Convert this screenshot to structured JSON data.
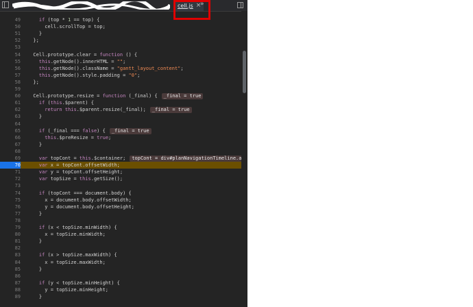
{
  "tabs": {
    "active_label": "cell.js",
    "close_glyph": "×",
    "overflow_glyph": "»"
  },
  "lines": [
    {
      "n": "49",
      "t": "    if (top * 1 == top) {"
    },
    {
      "n": "50",
      "t": "      cell.scrollTop = top;"
    },
    {
      "n": "51",
      "t": "    }"
    },
    {
      "n": "52",
      "t": "  };"
    },
    {
      "n": "53",
      "t": ""
    },
    {
      "n": "54",
      "t": "  Cell.prototype.clear = function () {"
    },
    {
      "n": "55",
      "t": "    this.getNode().innerHTML = \"\";"
    },
    {
      "n": "56",
      "t": "    this.getNode().className = \"gantt_layout_content\";"
    },
    {
      "n": "57",
      "t": "    this.getNode().style.padding = \"0\";"
    },
    {
      "n": "58",
      "t": "  };"
    },
    {
      "n": "59",
      "t": ""
    },
    {
      "n": "60",
      "t": "  Cell.prototype.resize = function (_final) {",
      "hint": "_final = true"
    },
    {
      "n": "61",
      "t": "    if (this.$parent) {"
    },
    {
      "n": "62",
      "t": "      return this.$parent.resize(_final);",
      "hint": "_final = true"
    },
    {
      "n": "63",
      "t": "    }"
    },
    {
      "n": "64",
      "t": ""
    },
    {
      "n": "65",
      "t": "    if (_final === false) {",
      "hint": "_final = true"
    },
    {
      "n": "66",
      "t": "      this.$preResize = true;"
    },
    {
      "n": "67",
      "t": "    }"
    },
    {
      "n": "68",
      "t": ""
    },
    {
      "n": "69",
      "t": "    var topCont = this.$container;",
      "hint": "topCont = div#planNavigationTimeline.aw-gan"
    },
    {
      "n": "70",
      "t": "    var x = topCont.offsetWidth;",
      "current": true
    },
    {
      "n": "71",
      "t": "    var y = topCont.offsetHeight;"
    },
    {
      "n": "72",
      "t": "    var topSize = this.getSize();"
    },
    {
      "n": "73",
      "t": ""
    },
    {
      "n": "74",
      "t": "    if (topCont === document.body) {"
    },
    {
      "n": "75",
      "t": "      x = document.body.offsetWidth;"
    },
    {
      "n": "76",
      "t": "      y = document.body.offsetHeight;"
    },
    {
      "n": "77",
      "t": "    }"
    },
    {
      "n": "78",
      "t": ""
    },
    {
      "n": "79",
      "t": "    if (x < topSize.minWidth) {"
    },
    {
      "n": "80",
      "t": "      x = topSize.minWidth;"
    },
    {
      "n": "81",
      "t": "    }"
    },
    {
      "n": "82",
      "t": ""
    },
    {
      "n": "83",
      "t": "    if (x > topSize.maxWidth) {"
    },
    {
      "n": "84",
      "t": "      x = topSize.maxWidth;"
    },
    {
      "n": "85",
      "t": "    }"
    },
    {
      "n": "86",
      "t": ""
    },
    {
      "n": "87",
      "t": "    if (y < topSize.minHeight) {"
    },
    {
      "n": "88",
      "t": "      y = topSize.minHeight;"
    },
    {
      "n": "89",
      "t": "    }"
    }
  ]
}
